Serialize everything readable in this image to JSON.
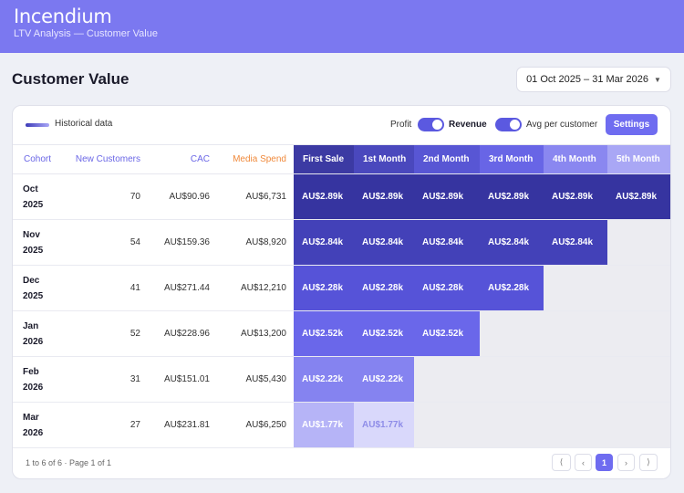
{
  "app": {
    "name": "Incendium",
    "subtitle": "LTV Analysis — Customer Value"
  },
  "page": {
    "title": "Customer Value",
    "date_range": "01 Oct 2025 – 31 Mar 2026"
  },
  "toolbar": {
    "legend_label": "Historical data",
    "profit_label": "Profit",
    "revenue_label": "Revenue",
    "avg_label": "Avg per customer",
    "settings_label": "Settings"
  },
  "table": {
    "headers": {
      "cohort": "Cohort",
      "new_customers": "New Customers",
      "cac": "CAC",
      "media_spend": "Media Spend",
      "months": [
        "First Sale",
        "1st Month",
        "2nd Month",
        "3rd Month",
        "4th Month",
        "5th Month"
      ]
    },
    "header_colors": [
      "#3c3aa3",
      "#4a48bd",
      "#5856d4",
      "#6865e6",
      "#8a87f0",
      "#a9a7f5"
    ],
    "rows": [
      {
        "cohort": "Oct\n2025",
        "new_customers": "70",
        "cac": "AU$90.96",
        "media_spend": "AU$6,731",
        "values": [
          "AU$2.89k",
          "AU$2.89k",
          "AU$2.89k",
          "AU$2.89k",
          "AU$2.89k",
          "AU$2.89k"
        ],
        "colors": [
          "#3634a0",
          "#3634a0",
          "#3634a0",
          "#3634a0",
          "#3634a0",
          "#3634a0"
        ]
      },
      {
        "cohort": "Nov\n2025",
        "new_customers": "54",
        "cac": "AU$159.36",
        "media_spend": "AU$8,920",
        "values": [
          "AU$2.84k",
          "AU$2.84k",
          "AU$2.84k",
          "AU$2.84k",
          "AU$2.84k"
        ],
        "colors": [
          "#4341b8",
          "#4341b8",
          "#4341b8",
          "#4341b8",
          "#4341b8"
        ]
      },
      {
        "cohort": "Dec\n2025",
        "new_customers": "41",
        "cac": "AU$271.44",
        "media_spend": "AU$12,210",
        "values": [
          "AU$2.28k",
          "AU$2.28k",
          "AU$2.28k",
          "AU$2.28k"
        ],
        "colors": [
          "#5653d8",
          "#5653d8",
          "#5653d8",
          "#5653d8"
        ]
      },
      {
        "cohort": "Jan\n2026",
        "new_customers": "52",
        "cac": "AU$228.96",
        "media_spend": "AU$13,200",
        "values": [
          "AU$2.52k",
          "AU$2.52k",
          "AU$2.52k"
        ],
        "colors": [
          "#6a67ea",
          "#6a67ea",
          "#6a67ea"
        ]
      },
      {
        "cohort": "Feb\n2026",
        "new_customers": "31",
        "cac": "AU$151.01",
        "media_spend": "AU$5,430",
        "values": [
          "AU$2.22k",
          "AU$2.22k"
        ],
        "colors": [
          "#8583f0",
          "#8583f0"
        ]
      },
      {
        "cohort": "Mar\n2026",
        "new_customers": "27",
        "cac": "AU$231.81",
        "media_spend": "AU$6,250",
        "values": [
          "AU$1.77k",
          "AU$1.77k"
        ],
        "colors": [
          "#b6b4f7",
          "#d9d8fb"
        ],
        "text_colors": [
          "#ffffff",
          "#8f8de8"
        ]
      }
    ]
  },
  "footer": {
    "summary": "1 to 6 of 6  ·  Page 1 of 1",
    "pager": {
      "first": "⟨",
      "prev": "‹",
      "page": "1",
      "next": "›",
      "last": "⟩"
    }
  }
}
